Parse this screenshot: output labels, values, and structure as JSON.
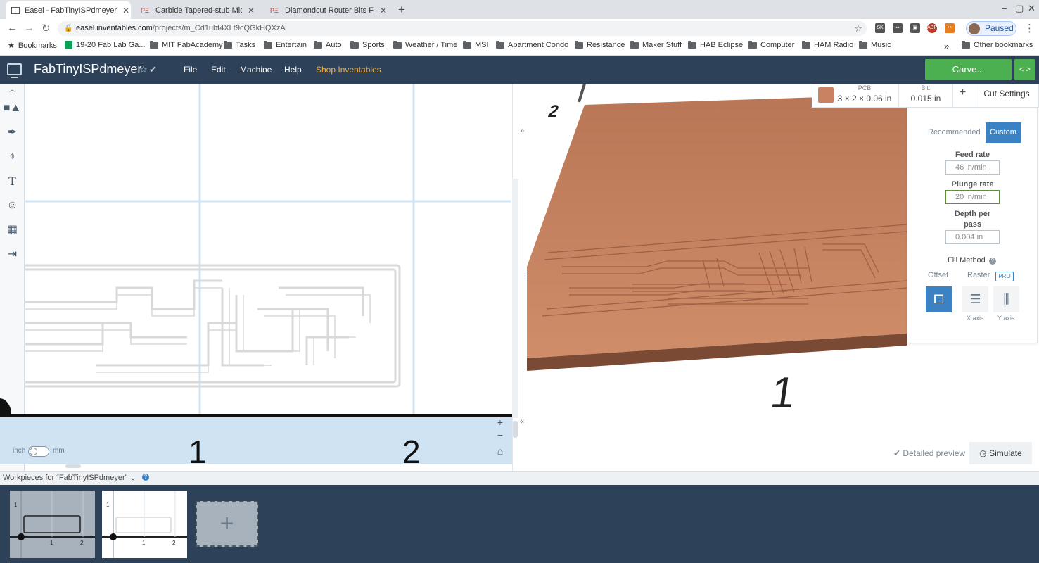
{
  "browser": {
    "tabs": [
      {
        "title": "Easel - FabTinyISPdmeyer",
        "active": true
      },
      {
        "title": "Carbide Tapered-stub Micro-d",
        "active": false
      },
      {
        "title": "Diamondcut Router Bits Feed",
        "active": false
      }
    ],
    "new_tab": "+",
    "url_host": "easel.inventables.com",
    "url_path": "/projects/m_Cd1ubt4XLt9cQGkHQXzA",
    "profile_status": "Paused",
    "window_controls": {
      "minimize": "–",
      "maximize": "▢",
      "close": "✕"
    },
    "bookmarks": [
      {
        "label": "Bookmarks",
        "icon": "star-icon"
      },
      {
        "label": "19-20 Fab Lab Ga...",
        "icon": "sheets-icon"
      },
      {
        "label": "MIT FabAcademy",
        "icon": "folder-icon"
      },
      {
        "label": "Tasks",
        "icon": "folder-icon"
      },
      {
        "label": "Entertain",
        "icon": "folder-icon"
      },
      {
        "label": "Auto",
        "icon": "folder-icon"
      },
      {
        "label": "Sports",
        "icon": "folder-icon"
      },
      {
        "label": "Weather / Time",
        "icon": "folder-icon"
      },
      {
        "label": "MSI",
        "icon": "folder-icon"
      },
      {
        "label": "Apartment Condo",
        "icon": "folder-icon"
      },
      {
        "label": "Resistance",
        "icon": "folder-icon"
      },
      {
        "label": "Maker Stuff",
        "icon": "folder-icon"
      },
      {
        "label": "HAB Eclipse",
        "icon": "folder-icon"
      },
      {
        "label": "Computer",
        "icon": "folder-icon"
      },
      {
        "label": "HAM Radio",
        "icon": "folder-icon"
      },
      {
        "label": "Music",
        "icon": "folder-icon"
      }
    ],
    "more_bookmarks": "»",
    "other_bookmarks": "Other bookmarks"
  },
  "app": {
    "project_title": "FabTinyISPdmeyer",
    "menu": {
      "file": "File",
      "edit": "Edit",
      "machine": "Machine",
      "help": "Help",
      "shop": "Shop Inventables"
    },
    "carve_label": "Carve...",
    "expand_label": "< >",
    "accent_color": "#4caf50",
    "header_color": "#2d4259"
  },
  "canvas2d": {
    "ruler_numbers": [
      "1",
      "2"
    ],
    "unit_inch": "inch",
    "unit_mm": "mm",
    "zoom_in": "+",
    "zoom_out": "−",
    "home": "⌂"
  },
  "preview3d": {
    "axis_labels": [
      "2",
      "1"
    ],
    "material": {
      "label": "PCB",
      "size": "3 × 2 × 0.06 in",
      "color": "#c98262"
    },
    "bit": {
      "label": "Bit:",
      "size": "0.015 in"
    },
    "add": "+",
    "cut_settings_label": "Cut Settings",
    "cut_settings": {
      "recommended": "Recommended",
      "custom": "Custom",
      "feed_rate_label": "Feed rate",
      "feed_rate_value": "46 in/min",
      "plunge_rate_label": "Plunge rate",
      "plunge_rate_value": "20 in/min",
      "depth_per_pass_label": "Depth per pass",
      "depth_per_pass_value": "0.004 in",
      "fill_method_label": "Fill Method",
      "fill_help": "?",
      "offset_label": "Offset",
      "raster_label": "Raster",
      "pro_badge": "PRO",
      "x_axis": "X axis",
      "y_axis": "Y axis"
    },
    "detailed_preview": "Detailed preview",
    "simulate": "Simulate"
  },
  "workpieces": {
    "label": "Workpieces for “FabTinyISPdmeyer”",
    "help": "?",
    "add": "+",
    "thumb_axis_numbers": [
      "1",
      "1",
      "2"
    ]
  }
}
